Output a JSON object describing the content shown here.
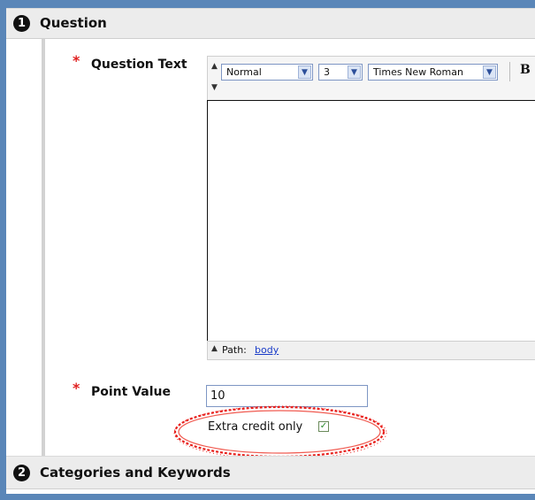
{
  "section1": {
    "number": "1",
    "title": "Question"
  },
  "question_text": {
    "required_marker": "*",
    "label": "Question Text",
    "toolbar": {
      "format_select": "Normal",
      "size_select": "3",
      "font_select": "Times New Roman",
      "bold_button": "B"
    },
    "editor_value": "",
    "status": {
      "path_label": "Path:",
      "path_link": "body"
    }
  },
  "point_value": {
    "required_marker": "*",
    "label": "Point Value",
    "value": "10",
    "extra_credit_label": "Extra credit only",
    "extra_credit_checked": true
  },
  "section2": {
    "number": "2",
    "title": "Categories and Keywords"
  },
  "colors": {
    "frame": "#5a86b8",
    "required": "#e02020",
    "highlight_scribble": "#e8201c",
    "link": "#1a3cc8"
  }
}
